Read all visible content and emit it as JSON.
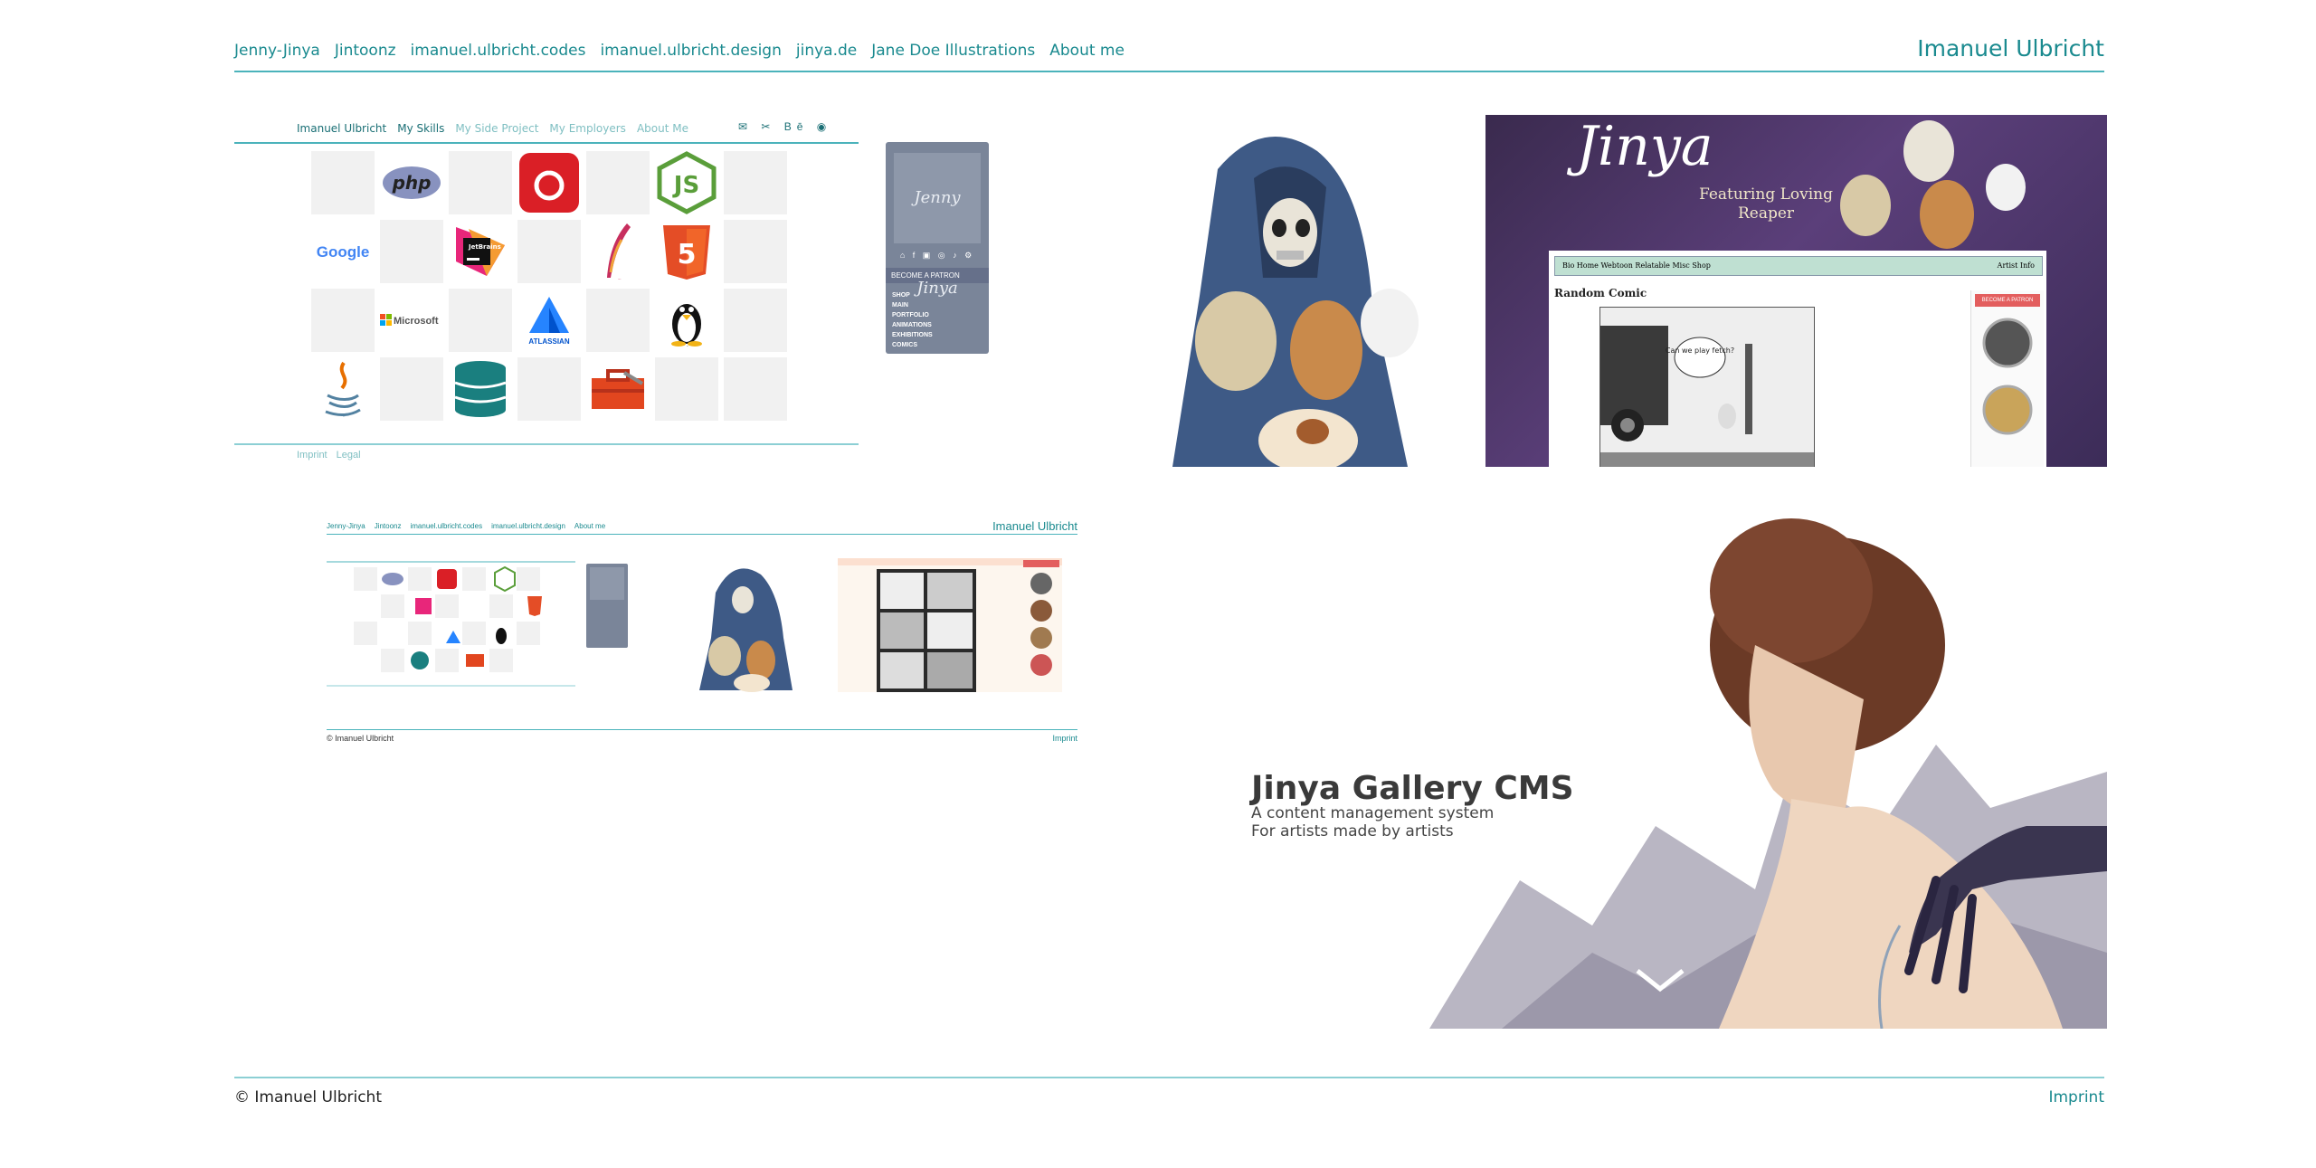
{
  "header": {
    "nav": [
      "Jenny-Jinya",
      "Jintoonz",
      "imanuel.ulbricht.codes",
      "imanuel.ulbricht.design",
      "jinya.de",
      "Jane Doe Illustrations",
      "About me"
    ],
    "brand": "Imanuel Ulbricht"
  },
  "tiles": {
    "skills": {
      "nav": [
        "Imanuel Ulbricht",
        "My Skills",
        "My Side Project",
        "My Employers",
        "About Me"
      ],
      "socials": "✉ ✂ Bē ◉",
      "logos": [
        "",
        "php",
        "",
        "CC",
        "",
        "JS",
        "",
        "Google",
        "",
        "JetBrains",
        "",
        "feather",
        "5",
        "",
        "",
        "Microsoft",
        "",
        "ATLASSIAN",
        "",
        "Tux",
        "",
        "Java",
        "",
        "DB",
        "",
        "Toolbox",
        "",
        ""
      ],
      "footer_links": [
        "Imprint",
        "Legal"
      ]
    },
    "patreon": {
      "signature": "Jenny Jinya",
      "icons": "⌂ f ▣ ◎ ♪ ⚙",
      "become": "BECOME A PATRON",
      "menu": [
        "SHOP",
        "MAIN",
        "PORTFOLIO",
        "ANIMATIONS",
        "EXHIBITIONS",
        "COMICS"
      ]
    },
    "reaper": {
      "script": "Jinya",
      "featuring": "Featuring Loving Reaper",
      "bar_links": "Bio Home   Webtoon   Relatable   Misc   Shop",
      "artist_info": "Artist Info",
      "random_comic": "Random Comic",
      "patron": "BECOME A PATRON",
      "speech": "Can we play fetch?"
    },
    "mini": {
      "nav": [
        "Jenny-Jinya",
        "Jintoonz",
        "imanuel.ulbricht.codes",
        "imanuel.ulbricht.design",
        "About me"
      ],
      "brand": "Imanuel Ulbricht",
      "copyright": "© Imanuel Ulbricht",
      "imprint": "Imprint"
    },
    "jinya": {
      "title": "Jinya Gallery CMS",
      "line1": "A content management system",
      "line2": "For artists made by artists"
    }
  },
  "footer": {
    "copyright": "© Imanuel Ulbricht",
    "imprint": "Imprint"
  },
  "colors": {
    "accent": "#1a8a8f",
    "rule": "#4bb3bb",
    "patreon_panel": "#7a8599"
  }
}
